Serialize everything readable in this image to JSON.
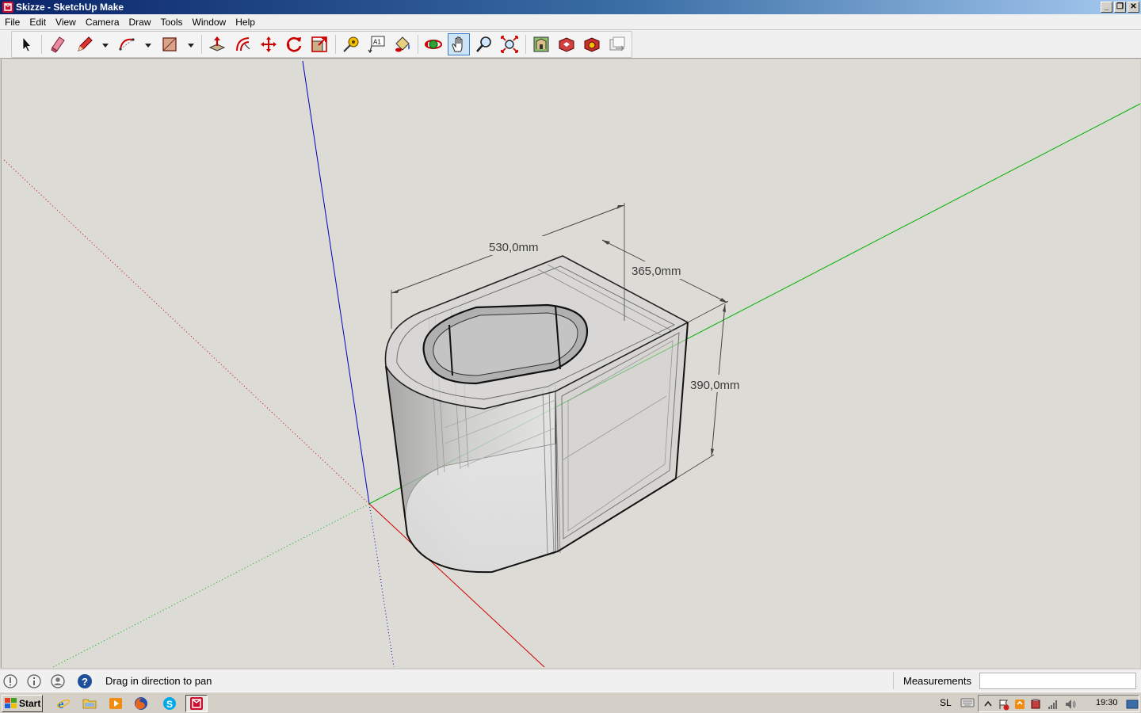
{
  "window": {
    "title": "Skizze - SketchUp Make",
    "controls": [
      "minimize",
      "maximize",
      "close"
    ]
  },
  "menu": {
    "items": [
      "File",
      "Edit",
      "View",
      "Camera",
      "Draw",
      "Tools",
      "Window",
      "Help"
    ]
  },
  "toolbar": {
    "tools": [
      {
        "name": "select-tool",
        "icon": "arrow-cursor-icon"
      },
      {
        "name": "eraser-tool",
        "icon": "eraser-icon"
      },
      {
        "name": "line-tool",
        "icon": "pencil-icon",
        "has_dropdown": true
      },
      {
        "name": "arc-tool",
        "icon": "arc-icon",
        "has_dropdown": true
      },
      {
        "name": "rectangle-tool",
        "icon": "rectangle-icon",
        "has_dropdown": true
      },
      {
        "name": "push-pull-tool",
        "icon": "push-pull-icon"
      },
      {
        "name": "offset-tool",
        "icon": "offset-icon"
      },
      {
        "name": "move-tool",
        "icon": "move-icon"
      },
      {
        "name": "rotate-tool",
        "icon": "rotate-icon"
      },
      {
        "name": "scale-tool",
        "icon": "scale-icon"
      },
      {
        "name": "tape-measure-tool",
        "icon": "tape-measure-icon"
      },
      {
        "name": "text-tool",
        "icon": "text-icon",
        "label": "A1"
      },
      {
        "name": "paint-bucket-tool",
        "icon": "paint-bucket-icon"
      },
      {
        "name": "orbit-tool",
        "icon": "orbit-icon"
      },
      {
        "name": "pan-tool",
        "icon": "hand-icon",
        "active": true
      },
      {
        "name": "zoom-tool",
        "icon": "magnifier-icon"
      },
      {
        "name": "zoom-extents-tool",
        "icon": "zoom-extents-icon"
      },
      {
        "name": "warehouse-button",
        "icon": "warehouse-icon"
      },
      {
        "name": "share-model-button",
        "icon": "share-model-icon"
      },
      {
        "name": "extension-warehouse-button",
        "icon": "extension-warehouse-icon"
      },
      {
        "name": "send-to-layout-button",
        "icon": "layout-icon"
      }
    ]
  },
  "model": {
    "dimensions": {
      "width": "530,0mm",
      "depth": "365,0mm",
      "height": "390,0mm"
    },
    "colors": {
      "axis_red": "#d00000",
      "axis_green": "#00b000",
      "axis_blue": "#0000c0",
      "background": "#dddbd5"
    }
  },
  "statusbar": {
    "icons": [
      "geo-location-icon",
      "info-icon",
      "user-icon",
      "help-icon"
    ],
    "message": "Drag in direction to pan",
    "measurements_label": "Measurements",
    "measurements_value": ""
  },
  "taskbar": {
    "start_label": "Start",
    "apps": [
      "internet-explorer-icon",
      "folder-icon",
      "media-player-icon",
      "firefox-icon",
      "skype-icon",
      "sketchup-icon"
    ],
    "language": "SL",
    "clock": "19:30"
  }
}
